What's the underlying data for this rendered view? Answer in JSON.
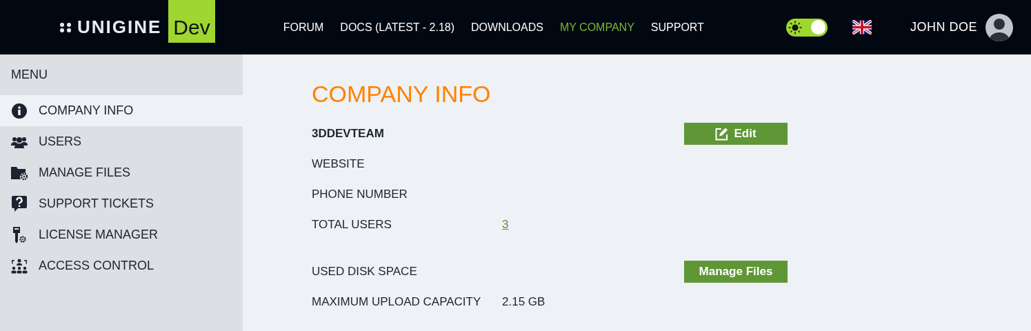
{
  "header": {
    "logo": {
      "wordmark": "UNIGINE",
      "badge": "Dev"
    },
    "nav": [
      {
        "label": "FORUM",
        "selected": false
      },
      {
        "label": "DOCS (LATEST - 2.18)",
        "selected": false
      },
      {
        "label": "DOWNLOADS",
        "selected": false
      },
      {
        "label": "MY COMPANY",
        "selected": true
      },
      {
        "label": "SUPPORT",
        "selected": false
      }
    ],
    "theme_toggle": {
      "on": true
    },
    "user": {
      "name": "JOHN DOE"
    }
  },
  "sidebar": {
    "title": "MENU",
    "items": [
      {
        "label": "COMPANY INFO",
        "selected": true
      },
      {
        "label": "USERS",
        "selected": false
      },
      {
        "label": "MANAGE FILES",
        "selected": false
      },
      {
        "label": "SUPPORT TICKETS",
        "selected": false
      },
      {
        "label": "LICENSE MANAGER",
        "selected": false
      },
      {
        "label": "ACCESS CONTROL",
        "selected": false
      }
    ]
  },
  "content": {
    "title": "COMPANY INFO",
    "company_name": "3DDEVTEAM",
    "edit_button": "Edit",
    "sections": [
      {
        "fields": [
          {
            "label": "WEBSITE"
          },
          {
            "label": "PHONE NUMBER"
          },
          {
            "label": "TOTAL USERS",
            "value": "3",
            "kind": "link"
          }
        ]
      },
      {
        "fields": [
          {
            "label": "USED DISK SPACE",
            "button": "Manage Files"
          },
          {
            "label": "MAXIMUM UPLOAD CAPACITY",
            "value": "2.15 GB",
            "kind": "text"
          }
        ]
      }
    ]
  }
}
